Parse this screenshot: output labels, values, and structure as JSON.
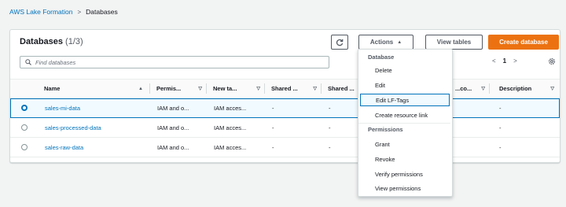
{
  "breadcrumb": {
    "root": "AWS Lake Formation",
    "separator": ">",
    "current": "Databases"
  },
  "panel": {
    "title": "Databases",
    "count": "(1/3)"
  },
  "toolbar": {
    "actions_label": "Actions",
    "actions_caret": "▲",
    "view_tables_label": "View tables",
    "create_label": "Create database"
  },
  "search": {
    "placeholder": "Find databases"
  },
  "pagination": {
    "prev": "<",
    "page": "1",
    "next": ">"
  },
  "table": {
    "headers": [
      "Name",
      "Permis...",
      "New ta...",
      "Shared ...",
      "Shared ...",
      "...co...",
      "Description"
    ],
    "rows": [
      {
        "name": "sales-mi-data",
        "perm": "IAM and o...",
        "newtable": "IAM acces...",
        "shared1": "-",
        "shared2": "-",
        "desc": "-",
        "selected": true
      },
      {
        "name": "sales-processed-data",
        "perm": "IAM and o...",
        "newtable": "IAM acces...",
        "shared1": "-",
        "shared2": "-",
        "desc": "-",
        "selected": false
      },
      {
        "name": "sales-raw-data",
        "perm": "IAM and o...",
        "newtable": "IAM acces...",
        "shared1": "-",
        "shared2": "-",
        "desc": "-",
        "selected": false
      }
    ]
  },
  "actions_menu": {
    "database_header": "Database",
    "delete": "Delete",
    "edit": "Edit",
    "edit_lf_tags": "Edit LF-Tags",
    "create_resource_link": "Create resource link",
    "permissions_header": "Permissions",
    "grant": "Grant",
    "revoke": "Revoke",
    "verify_permissions": "Verify permissions",
    "view_permissions": "View permissions"
  },
  "colors": {
    "link": "#0073bb",
    "primary": "#ec7211",
    "selected_bg": "#f1faff"
  },
  "icons": [
    "refresh-icon",
    "search-icon",
    "settings-icon",
    "sort-icon",
    "filter-icon"
  ]
}
